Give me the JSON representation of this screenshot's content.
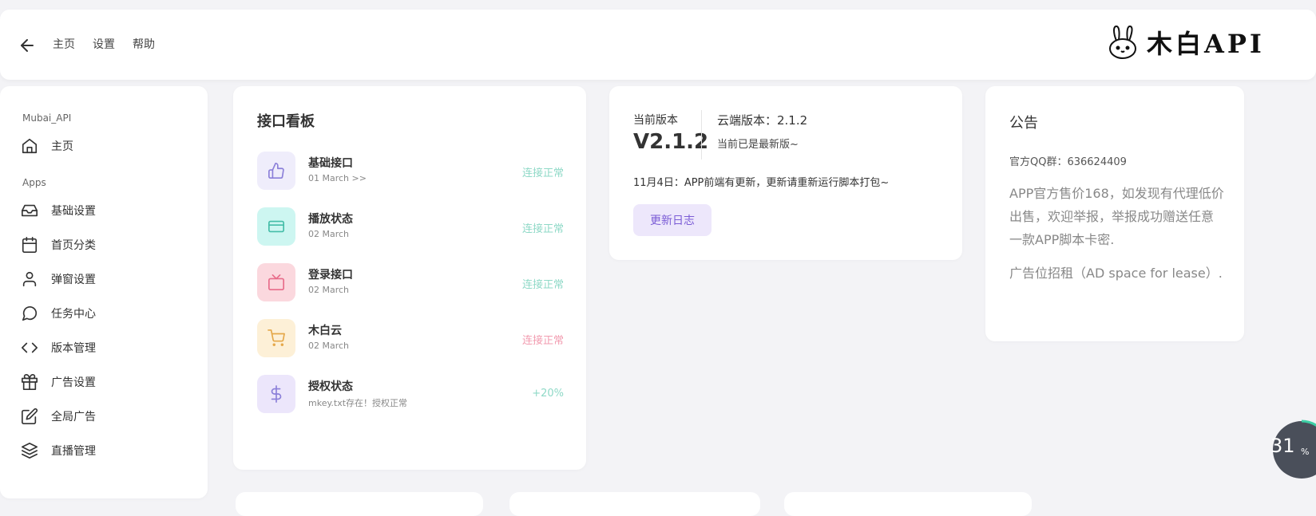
{
  "topbar": {
    "nav": [
      "主页",
      "设置",
      "帮助"
    ],
    "logo_text": "木白API"
  },
  "sidebar": {
    "section_main": "Mubai_API",
    "home": "主页",
    "section_apps": "Apps",
    "items": [
      {
        "label": "基础设置",
        "icon": "inbox-icon"
      },
      {
        "label": "首页分类",
        "icon": "calendar-icon"
      },
      {
        "label": "弹窗设置",
        "icon": "user-icon"
      },
      {
        "label": "任务中心",
        "icon": "message-circle-icon"
      },
      {
        "label": "版本管理",
        "icon": "code-icon"
      },
      {
        "label": "广告设置",
        "icon": "gift-icon"
      },
      {
        "label": "全局广告",
        "icon": "edit-icon"
      },
      {
        "label": "直播管理",
        "icon": "layers-icon"
      }
    ]
  },
  "board": {
    "title": "接口看板",
    "rows": [
      {
        "name": "基础接口",
        "sub": "01 March >>",
        "status": "连接正常",
        "status_color": "#8fd9c7",
        "icon": "thumbs-up-icon",
        "icon_bg": "#efedfb",
        "icon_color": "#8b7fd9"
      },
      {
        "name": "播放状态",
        "sub": "02 March",
        "status": "连接正常",
        "status_color": "#8fd9c7",
        "icon": "credit-card-icon",
        "icon_bg": "#cdf6f1",
        "icon_color": "#44bda8"
      },
      {
        "name": "登录接口",
        "sub": "02 March",
        "status": "连接正常",
        "status_color": "#8fd9c7",
        "icon": "tv-icon",
        "icon_bg": "#fbd8de",
        "icon_color": "#e86c8a"
      },
      {
        "name": "木白云",
        "sub": "02 March",
        "status": "连接正常",
        "status_color": "#f29cb0",
        "icon": "shopping-cart-icon",
        "icon_bg": "#fdf0d7",
        "icon_color": "#e5a84a"
      },
      {
        "name": "授权状态",
        "sub": "mkey.txt存在！授权正常",
        "status": "+20%",
        "status_color": "#8fd9c7",
        "icon": "dollar-icon",
        "icon_bg": "#ece6fb",
        "icon_color": "#8b7fd9"
      }
    ]
  },
  "version": {
    "label": "当前版本",
    "current": "V2.1.2",
    "cloud": "云端版本：2.1.2",
    "latest": "当前已是最新版~",
    "note": "11月4日：APP前端有更新，更新请重新运行脚本打包~",
    "button": "更新日志"
  },
  "notice": {
    "title": "公告",
    "qq": "官方QQ群：636624409",
    "text": "APP官方售价168，如发现有代理低价出售，欢迎举报，举报成功赠送任意一款APP脚本卡密.",
    "ad": "广告位招租（AD space for lease）."
  },
  "progress": {
    "value": "31",
    "unit": "%"
  }
}
